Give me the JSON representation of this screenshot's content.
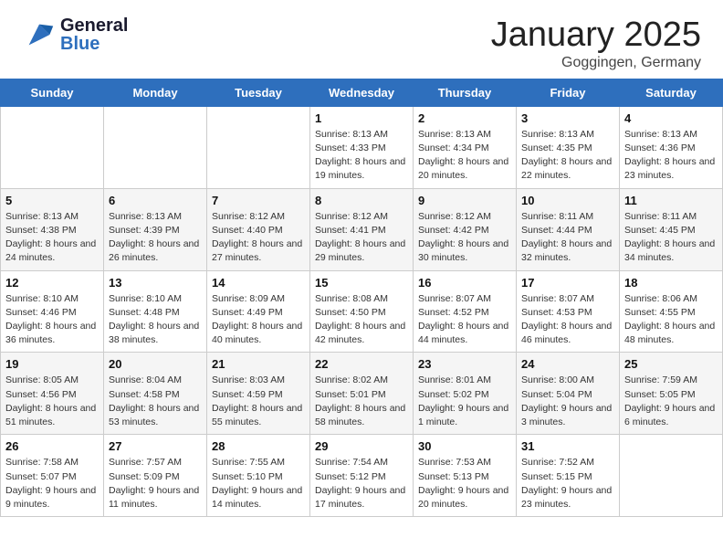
{
  "header": {
    "logo_general": "General",
    "logo_blue": "Blue",
    "title": "January 2025",
    "subtitle": "Goggingen, Germany"
  },
  "weekdays": [
    "Sunday",
    "Monday",
    "Tuesday",
    "Wednesday",
    "Thursday",
    "Friday",
    "Saturday"
  ],
  "weeks": [
    [
      {
        "day": "",
        "sunrise": "",
        "sunset": "",
        "daylight": ""
      },
      {
        "day": "",
        "sunrise": "",
        "sunset": "",
        "daylight": ""
      },
      {
        "day": "",
        "sunrise": "",
        "sunset": "",
        "daylight": ""
      },
      {
        "day": "1",
        "sunrise": "Sunrise: 8:13 AM",
        "sunset": "Sunset: 4:33 PM",
        "daylight": "Daylight: 8 hours and 19 minutes."
      },
      {
        "day": "2",
        "sunrise": "Sunrise: 8:13 AM",
        "sunset": "Sunset: 4:34 PM",
        "daylight": "Daylight: 8 hours and 20 minutes."
      },
      {
        "day": "3",
        "sunrise": "Sunrise: 8:13 AM",
        "sunset": "Sunset: 4:35 PM",
        "daylight": "Daylight: 8 hours and 22 minutes."
      },
      {
        "day": "4",
        "sunrise": "Sunrise: 8:13 AM",
        "sunset": "Sunset: 4:36 PM",
        "daylight": "Daylight: 8 hours and 23 minutes."
      }
    ],
    [
      {
        "day": "5",
        "sunrise": "Sunrise: 8:13 AM",
        "sunset": "Sunset: 4:38 PM",
        "daylight": "Daylight: 8 hours and 24 minutes."
      },
      {
        "day": "6",
        "sunrise": "Sunrise: 8:13 AM",
        "sunset": "Sunset: 4:39 PM",
        "daylight": "Daylight: 8 hours and 26 minutes."
      },
      {
        "day": "7",
        "sunrise": "Sunrise: 8:12 AM",
        "sunset": "Sunset: 4:40 PM",
        "daylight": "Daylight: 8 hours and 27 minutes."
      },
      {
        "day": "8",
        "sunrise": "Sunrise: 8:12 AM",
        "sunset": "Sunset: 4:41 PM",
        "daylight": "Daylight: 8 hours and 29 minutes."
      },
      {
        "day": "9",
        "sunrise": "Sunrise: 8:12 AM",
        "sunset": "Sunset: 4:42 PM",
        "daylight": "Daylight: 8 hours and 30 minutes."
      },
      {
        "day": "10",
        "sunrise": "Sunrise: 8:11 AM",
        "sunset": "Sunset: 4:44 PM",
        "daylight": "Daylight: 8 hours and 32 minutes."
      },
      {
        "day": "11",
        "sunrise": "Sunrise: 8:11 AM",
        "sunset": "Sunset: 4:45 PM",
        "daylight": "Daylight: 8 hours and 34 minutes."
      }
    ],
    [
      {
        "day": "12",
        "sunrise": "Sunrise: 8:10 AM",
        "sunset": "Sunset: 4:46 PM",
        "daylight": "Daylight: 8 hours and 36 minutes."
      },
      {
        "day": "13",
        "sunrise": "Sunrise: 8:10 AM",
        "sunset": "Sunset: 4:48 PM",
        "daylight": "Daylight: 8 hours and 38 minutes."
      },
      {
        "day": "14",
        "sunrise": "Sunrise: 8:09 AM",
        "sunset": "Sunset: 4:49 PM",
        "daylight": "Daylight: 8 hours and 40 minutes."
      },
      {
        "day": "15",
        "sunrise": "Sunrise: 8:08 AM",
        "sunset": "Sunset: 4:50 PM",
        "daylight": "Daylight: 8 hours and 42 minutes."
      },
      {
        "day": "16",
        "sunrise": "Sunrise: 8:07 AM",
        "sunset": "Sunset: 4:52 PM",
        "daylight": "Daylight: 8 hours and 44 minutes."
      },
      {
        "day": "17",
        "sunrise": "Sunrise: 8:07 AM",
        "sunset": "Sunset: 4:53 PM",
        "daylight": "Daylight: 8 hours and 46 minutes."
      },
      {
        "day": "18",
        "sunrise": "Sunrise: 8:06 AM",
        "sunset": "Sunset: 4:55 PM",
        "daylight": "Daylight: 8 hours and 48 minutes."
      }
    ],
    [
      {
        "day": "19",
        "sunrise": "Sunrise: 8:05 AM",
        "sunset": "Sunset: 4:56 PM",
        "daylight": "Daylight: 8 hours and 51 minutes."
      },
      {
        "day": "20",
        "sunrise": "Sunrise: 8:04 AM",
        "sunset": "Sunset: 4:58 PM",
        "daylight": "Daylight: 8 hours and 53 minutes."
      },
      {
        "day": "21",
        "sunrise": "Sunrise: 8:03 AM",
        "sunset": "Sunset: 4:59 PM",
        "daylight": "Daylight: 8 hours and 55 minutes."
      },
      {
        "day": "22",
        "sunrise": "Sunrise: 8:02 AM",
        "sunset": "Sunset: 5:01 PM",
        "daylight": "Daylight: 8 hours and 58 minutes."
      },
      {
        "day": "23",
        "sunrise": "Sunrise: 8:01 AM",
        "sunset": "Sunset: 5:02 PM",
        "daylight": "Daylight: 9 hours and 1 minute."
      },
      {
        "day": "24",
        "sunrise": "Sunrise: 8:00 AM",
        "sunset": "Sunset: 5:04 PM",
        "daylight": "Daylight: 9 hours and 3 minutes."
      },
      {
        "day": "25",
        "sunrise": "Sunrise: 7:59 AM",
        "sunset": "Sunset: 5:05 PM",
        "daylight": "Daylight: 9 hours and 6 minutes."
      }
    ],
    [
      {
        "day": "26",
        "sunrise": "Sunrise: 7:58 AM",
        "sunset": "Sunset: 5:07 PM",
        "daylight": "Daylight: 9 hours and 9 minutes."
      },
      {
        "day": "27",
        "sunrise": "Sunrise: 7:57 AM",
        "sunset": "Sunset: 5:09 PM",
        "daylight": "Daylight: 9 hours and 11 minutes."
      },
      {
        "day": "28",
        "sunrise": "Sunrise: 7:55 AM",
        "sunset": "Sunset: 5:10 PM",
        "daylight": "Daylight: 9 hours and 14 minutes."
      },
      {
        "day": "29",
        "sunrise": "Sunrise: 7:54 AM",
        "sunset": "Sunset: 5:12 PM",
        "daylight": "Daylight: 9 hours and 17 minutes."
      },
      {
        "day": "30",
        "sunrise": "Sunrise: 7:53 AM",
        "sunset": "Sunset: 5:13 PM",
        "daylight": "Daylight: 9 hours and 20 minutes."
      },
      {
        "day": "31",
        "sunrise": "Sunrise: 7:52 AM",
        "sunset": "Sunset: 5:15 PM",
        "daylight": "Daylight: 9 hours and 23 minutes."
      },
      {
        "day": "",
        "sunrise": "",
        "sunset": "",
        "daylight": ""
      }
    ]
  ]
}
